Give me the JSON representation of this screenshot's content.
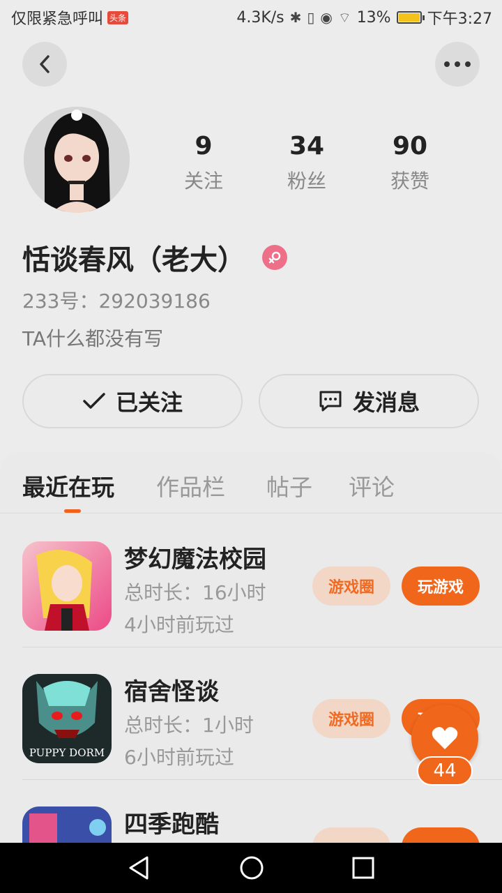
{
  "status_bar": {
    "left_text": "仅限紧急呼叫",
    "badge": "头条",
    "speed": "4.3K/s",
    "battery": "13%",
    "time": "下午3:27"
  },
  "profile": {
    "following_count": "9",
    "following_label": "关注",
    "fans_count": "34",
    "fans_label": "粉丝",
    "likes_count": "90",
    "likes_label": "获赞",
    "name": "恬谈春风（老大）",
    "uid": "233号：292039186",
    "bio": "TA什么都没有写"
  },
  "actions": {
    "follow_label": "已关注",
    "message_label": "发消息"
  },
  "tabs": [
    "最近在玩",
    "作品栏",
    "帖子",
    "评论"
  ],
  "games": [
    {
      "title": "梦幻魔法校园",
      "duration": "总时长：16小时",
      "last_played": "4小时前玩过",
      "circle_label": "游戏圈",
      "play_label": "玩游戏"
    },
    {
      "title": "宿舍怪谈",
      "duration": "总时长：1小时",
      "last_played": "6小时前玩过",
      "circle_label": "游戏圈",
      "play_label": "玩游戏",
      "icon_text": "PUPPY DORM"
    },
    {
      "title": "四季跑酷",
      "duration": "",
      "last_played": "",
      "circle_label": "",
      "play_label": ""
    }
  ],
  "float_like": {
    "count": "44"
  },
  "colors": {
    "accent": "#f0661b",
    "gender": "#ee6f88"
  }
}
